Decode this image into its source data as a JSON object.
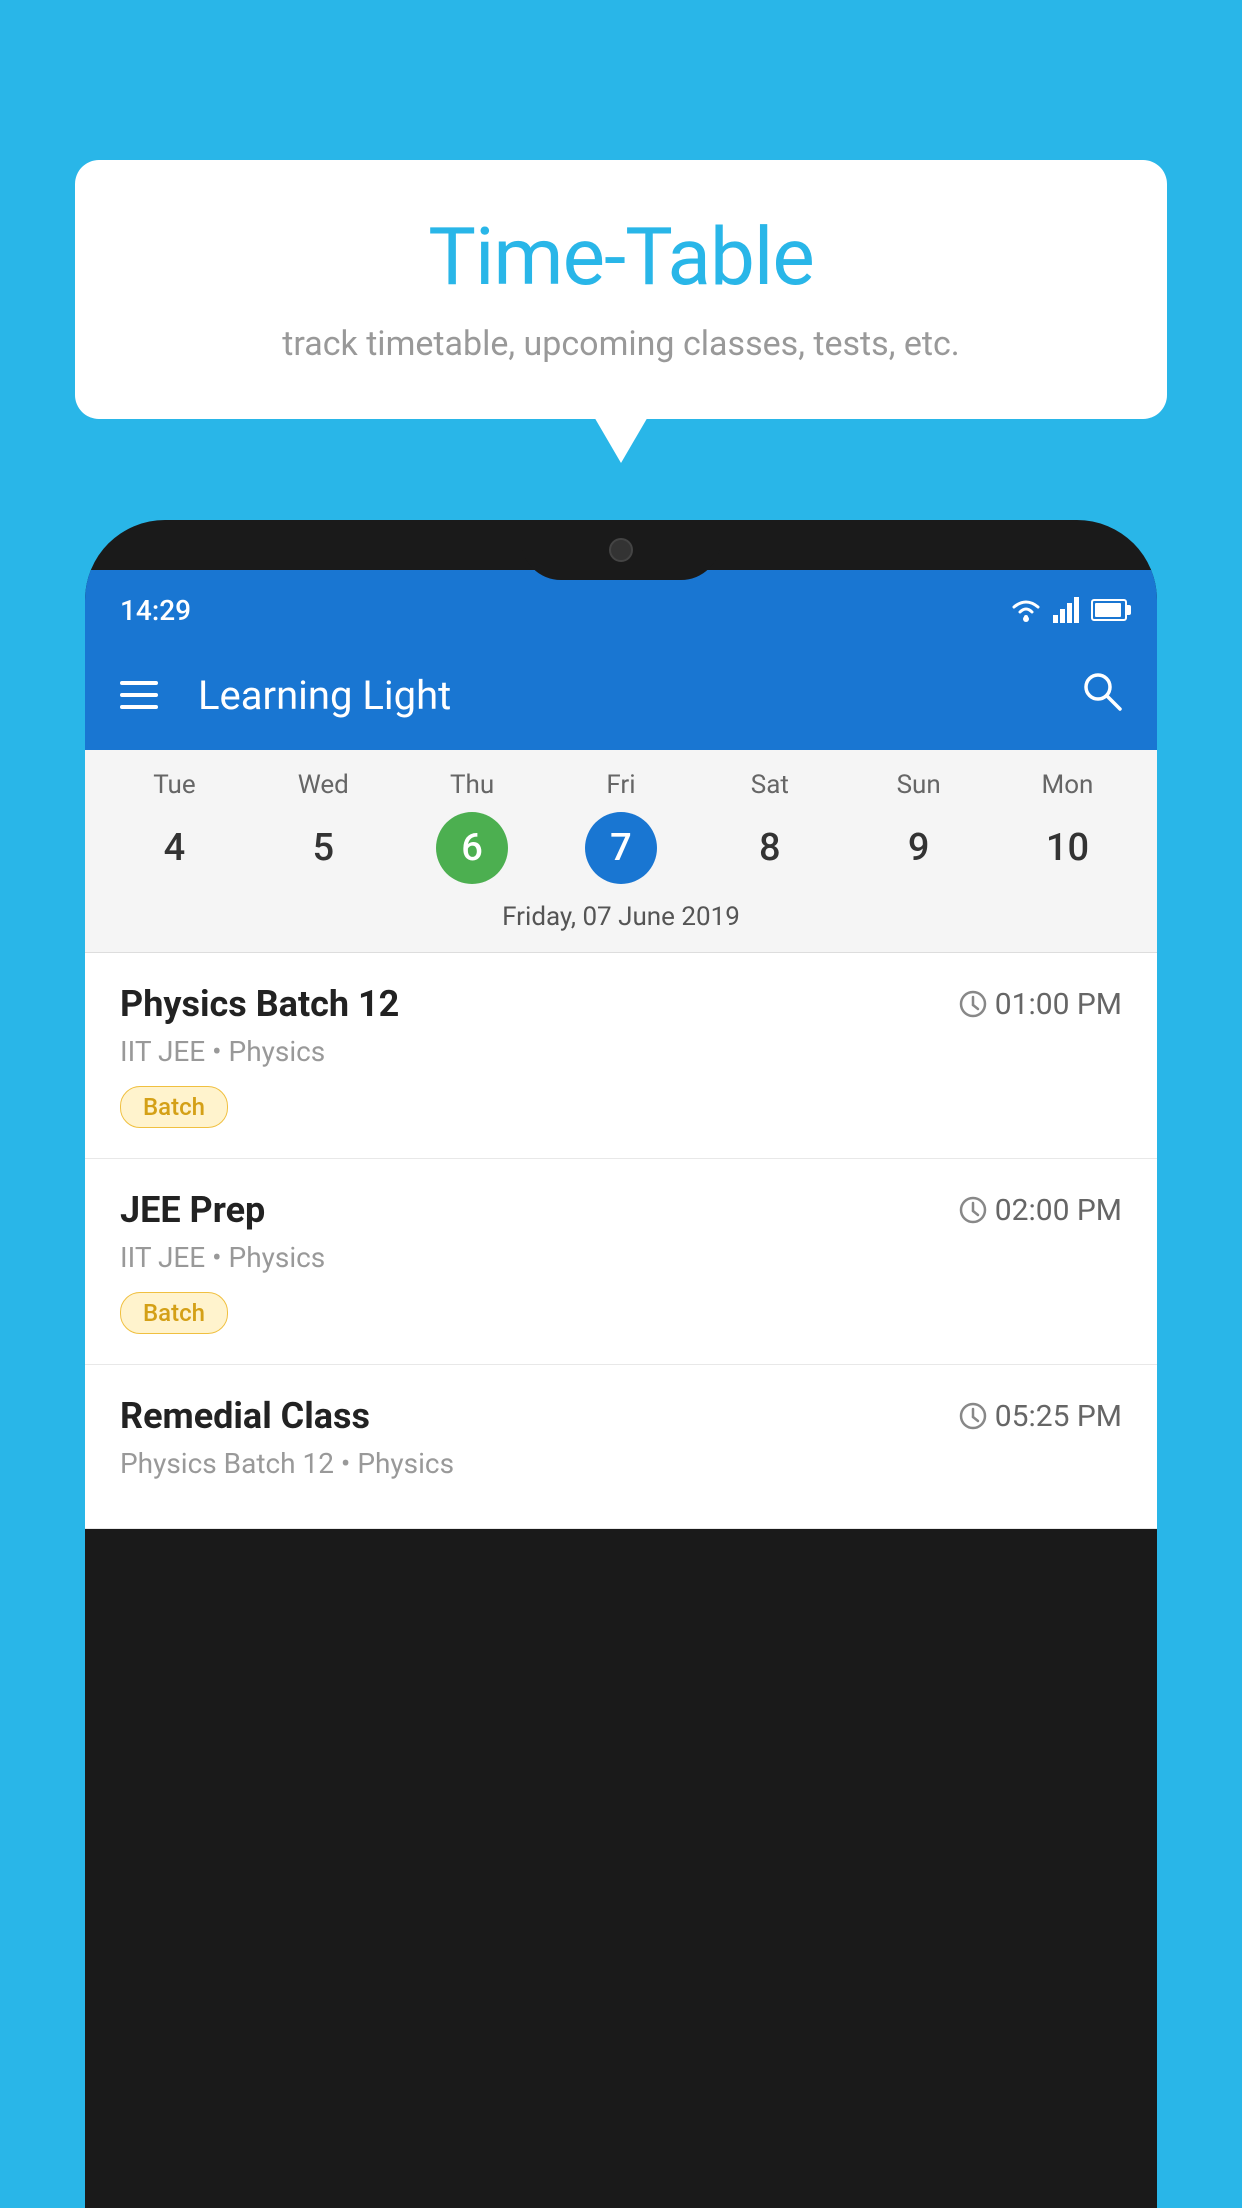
{
  "background_color": "#29B6E8",
  "speech_bubble": {
    "title": "Time-Table",
    "subtitle": "track timetable, upcoming classes, tests, etc."
  },
  "phone": {
    "status_bar": {
      "time": "14:29"
    },
    "toolbar": {
      "title": "Learning Light"
    },
    "calendar": {
      "days": [
        {
          "name": "Tue",
          "number": "4",
          "state": "normal"
        },
        {
          "name": "Wed",
          "number": "5",
          "state": "normal"
        },
        {
          "name": "Thu",
          "number": "6",
          "state": "today"
        },
        {
          "name": "Fri",
          "number": "7",
          "state": "selected"
        },
        {
          "name": "Sat",
          "number": "8",
          "state": "normal"
        },
        {
          "name": "Sun",
          "number": "9",
          "state": "normal"
        },
        {
          "name": "Mon",
          "number": "10",
          "state": "normal"
        }
      ],
      "selected_date": "Friday, 07 June 2019"
    },
    "schedule": [
      {
        "title": "Physics Batch 12",
        "time": "01:00 PM",
        "subtitle": "IIT JEE • Physics",
        "badge": "Batch"
      },
      {
        "title": "JEE Prep",
        "time": "02:00 PM",
        "subtitle": "IIT JEE • Physics",
        "badge": "Batch"
      },
      {
        "title": "Remedial Class",
        "time": "05:25 PM",
        "subtitle": "Physics Batch 12 • Physics",
        "badge": null
      }
    ]
  }
}
